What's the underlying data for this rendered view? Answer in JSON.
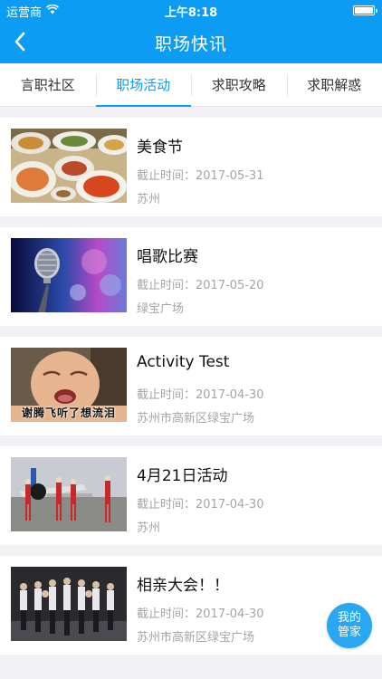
{
  "status_bar": {
    "carrier": "运营商",
    "time": "上午8:18",
    "wifi_icon": "wifi-icon",
    "battery_icon": "battery-icon"
  },
  "nav": {
    "title": "职场快讯",
    "back_icon": "chevron-left-icon"
  },
  "tabs": [
    {
      "label": "言职社区",
      "active": false
    },
    {
      "label": "职场活动",
      "active": true
    },
    {
      "label": "求职攻略",
      "active": false
    },
    {
      "label": "求职解惑",
      "active": false
    }
  ],
  "items": [
    {
      "title": "美食节",
      "deadline": "截止时间：2017-05-31",
      "location": "苏州"
    },
    {
      "title": "唱歌比赛",
      "deadline": "截止时间：2017-05-20",
      "location": "绿宝广场"
    },
    {
      "title": "Activity Test",
      "deadline": "截止时间：2017-04-30",
      "location": "苏州市高新区绿宝广场",
      "image_caption": "谢腾飞听了想流泪"
    },
    {
      "title": "4月21日活动",
      "deadline": "截止时间：2017-04-30",
      "location": "苏州"
    },
    {
      "title": "相亲大会！！",
      "deadline": "截止时间：2017-04-30",
      "location": "苏州市高新区绿宝广场"
    }
  ],
  "fab": {
    "line1": "我的",
    "line2": "管家"
  },
  "colors": {
    "primary": "#0c9cf4",
    "background": "#f0f0f5",
    "muted_text": "#a5a5a5"
  }
}
